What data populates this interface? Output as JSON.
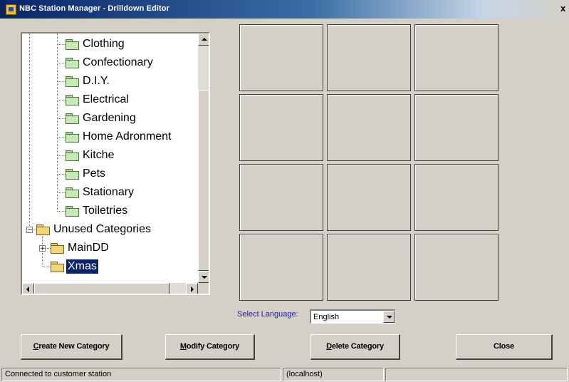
{
  "window": {
    "title": "NBC Station Manager - Drilldown Editor",
    "close_glyph": "x"
  },
  "tree": {
    "nodes": [
      {
        "label": "Clothing",
        "folder": "green",
        "selected": false
      },
      {
        "label": "Confectionary",
        "folder": "green",
        "selected": false
      },
      {
        "label": "D.I.Y.",
        "folder": "green",
        "selected": false
      },
      {
        "label": "Electrical",
        "folder": "green",
        "selected": false
      },
      {
        "label": "Gardening",
        "folder": "green",
        "selected": false
      },
      {
        "label": "Home Adronment",
        "folder": "green",
        "selected": false
      },
      {
        "label": "Kitche",
        "folder": "green",
        "selected": false
      },
      {
        "label": "Pets",
        "folder": "green",
        "selected": false
      },
      {
        "label": "Stationary",
        "folder": "green",
        "selected": false
      },
      {
        "label": "Toiletries",
        "folder": "green",
        "selected": false
      },
      {
        "label": "Unused Categories",
        "folder": "yellow",
        "expander": "−",
        "selected": false
      },
      {
        "label": "MainDD",
        "folder": "yellow",
        "expander": "+",
        "selected": false
      },
      {
        "label": "Xmas",
        "folder": "yellow-open",
        "selected": true
      }
    ]
  },
  "language": {
    "label": "Select Language:",
    "value": "English"
  },
  "buttons": {
    "create": {
      "accel": "C",
      "rest": "reate New Category"
    },
    "modify": {
      "accel": "M",
      "rest": "odify Category"
    },
    "delete": {
      "accel": "D",
      "rest": "elete Category"
    },
    "close": {
      "accel": "",
      "rest": "Close"
    }
  },
  "status": {
    "message": "Connected to customer station",
    "host": "(localhost)",
    "extra": ""
  },
  "colors": {
    "title_start": "#0a246a",
    "selection": "#0a246a",
    "face": "#d4d0c8",
    "lang_label": "#1a1aa0"
  }
}
